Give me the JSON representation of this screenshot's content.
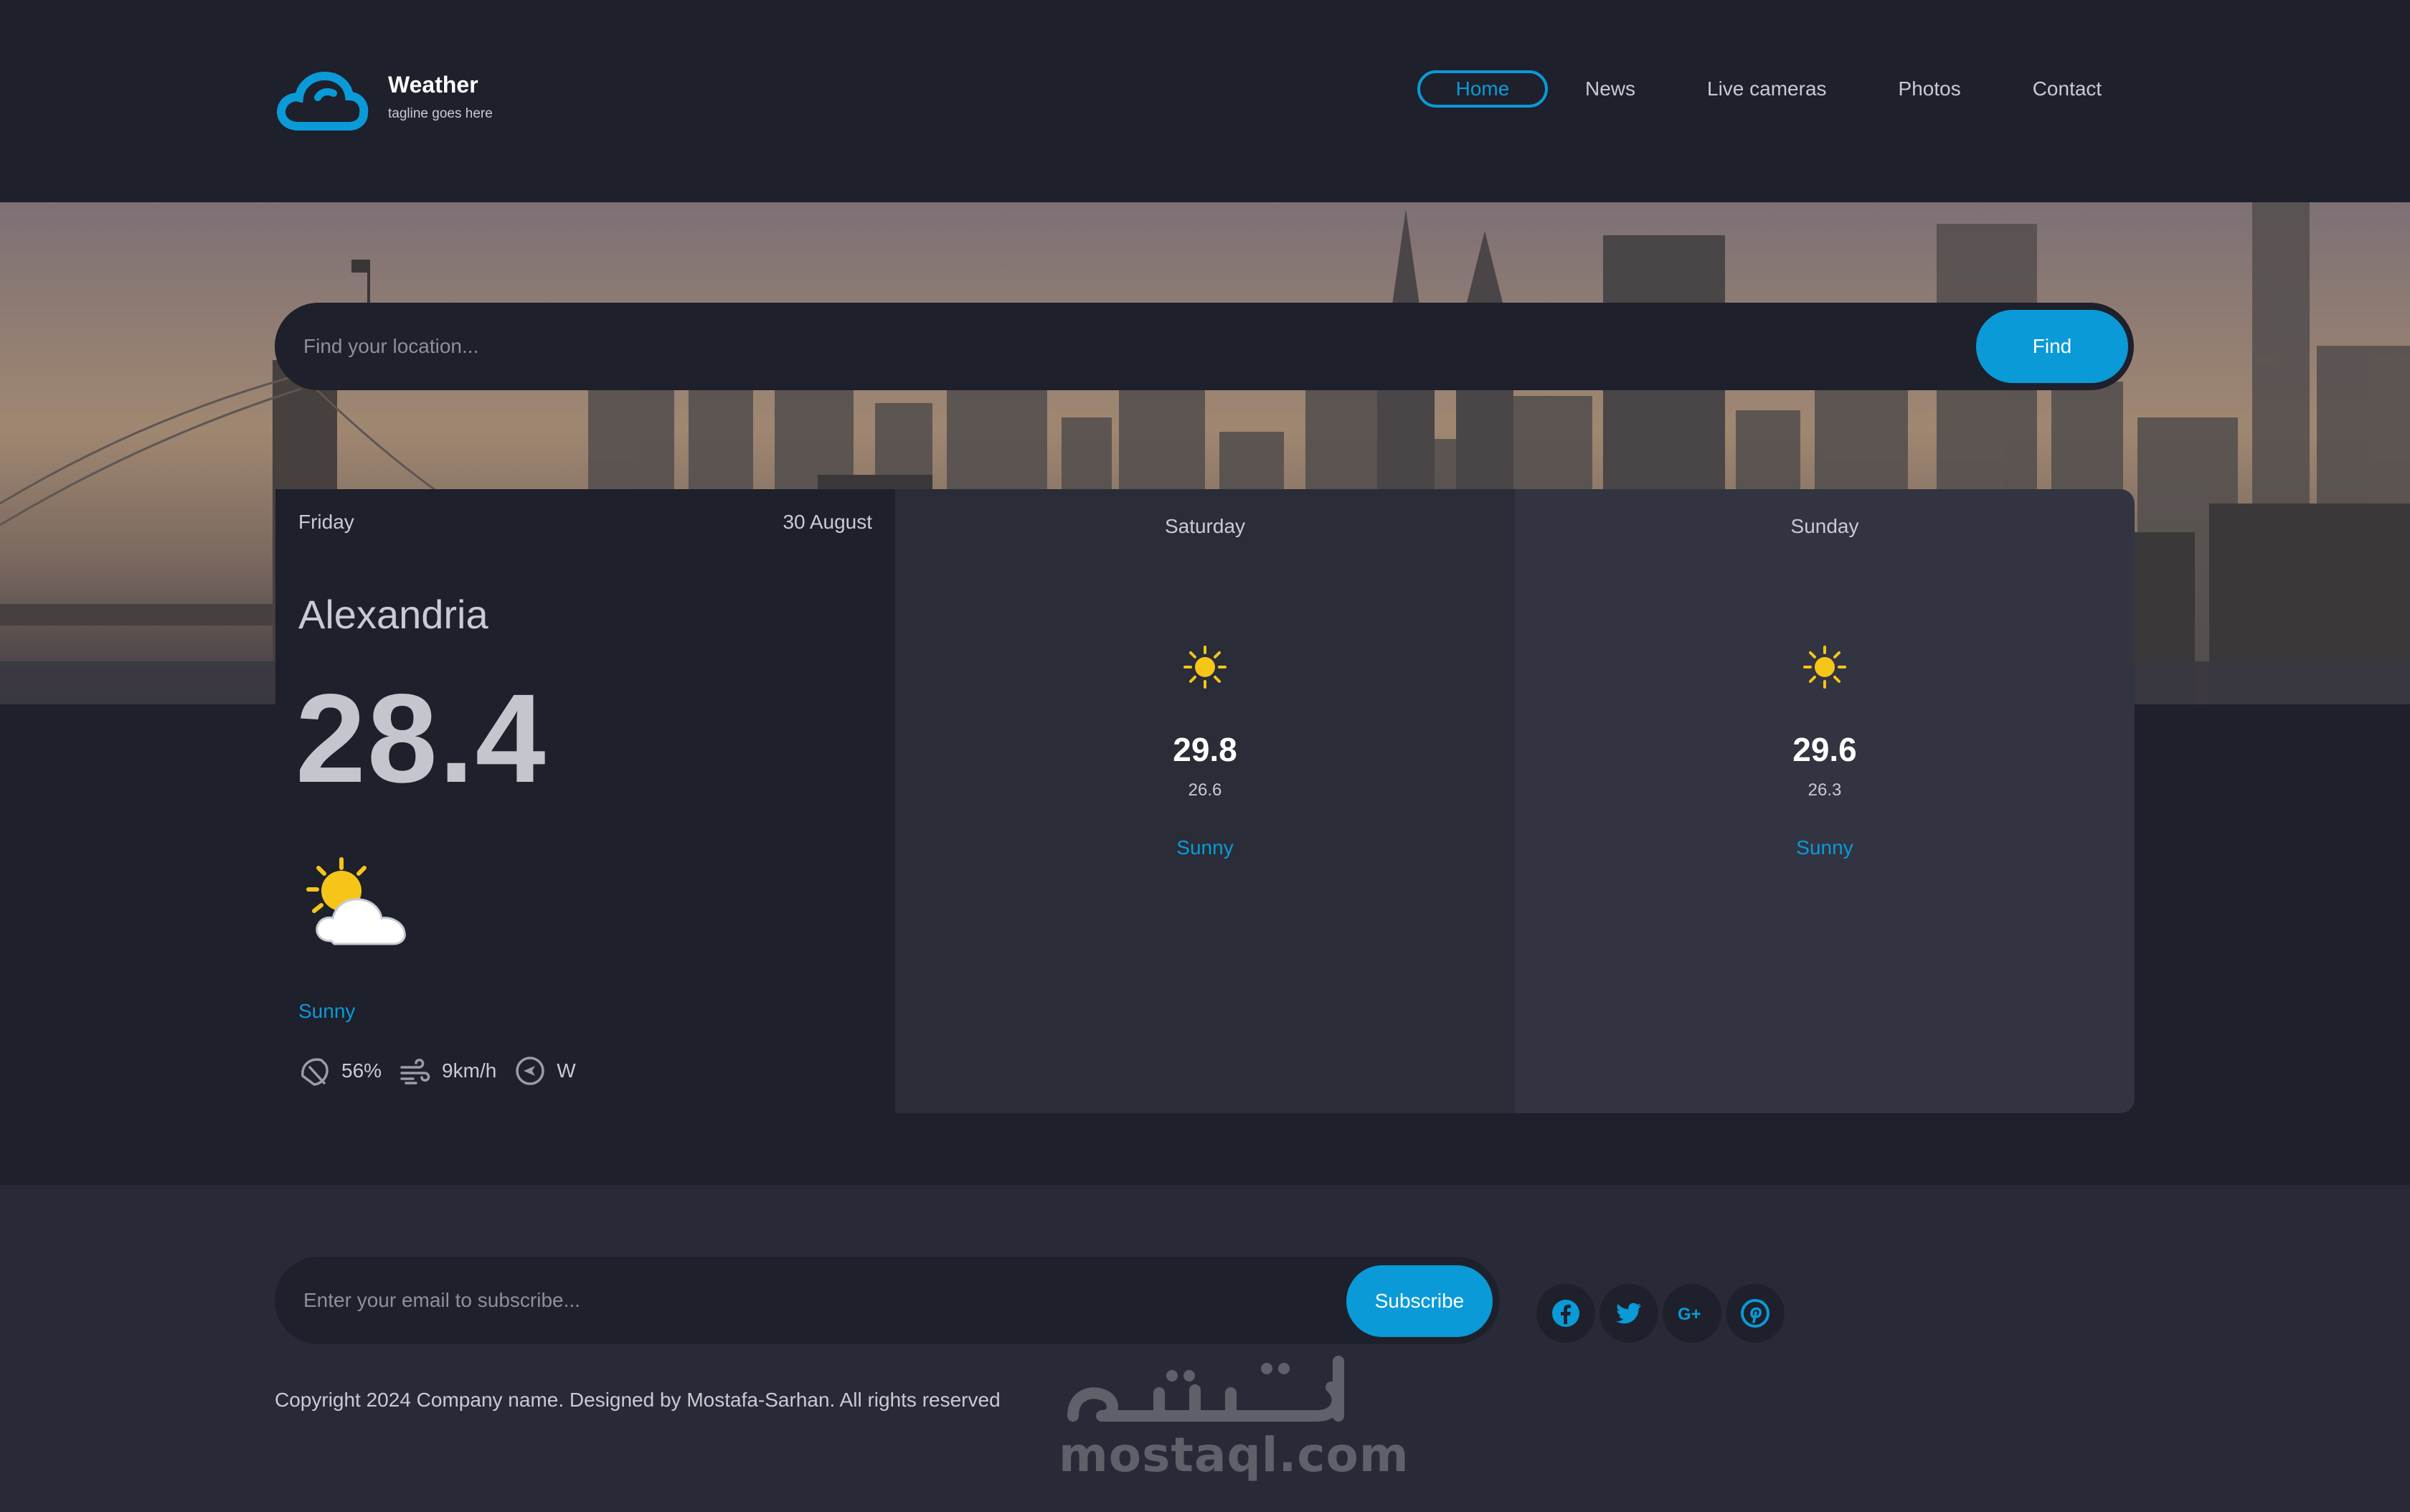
{
  "brand": {
    "title": "Weather",
    "tagline": "tagline goes here",
    "logo_icon": "cloud-icon"
  },
  "nav": {
    "items": [
      "Home",
      "News",
      "Live cameras",
      "Photos",
      "Contact"
    ],
    "active": "Home"
  },
  "search": {
    "placeholder": "Find your location...",
    "button": "Find"
  },
  "today": {
    "day": "Friday",
    "date": "30 August",
    "city": "Alexandria",
    "temp": "28.4",
    "icon": "partly-cloudy-icon",
    "condition": "Sunny",
    "stats": {
      "humidity": "56%",
      "wind": "9km/h",
      "direction": "W"
    }
  },
  "forecast": [
    {
      "day": "Saturday",
      "icon": "sun-icon",
      "max": "29.8",
      "min": "26.6",
      "condition": "Sunny"
    },
    {
      "day": "Sunday",
      "icon": "sun-icon",
      "max": "29.6",
      "min": "26.3",
      "condition": "Sunny"
    }
  ],
  "footer": {
    "email_placeholder": "Enter your email to subscribe...",
    "subscribe": "Subscribe",
    "socials": [
      "facebook-icon",
      "twitter-icon",
      "google-plus-icon",
      "pinterest-icon"
    ],
    "copyright": "Copyright 2024 Company name. Designed by Mostafa-Sarhan. All rights reserved"
  },
  "watermark": {
    "arabic": "مستقل",
    "latin": "mostaql.com"
  },
  "colors": {
    "accent": "#0a9ad8",
    "background": "#1e202b",
    "footer": "#282a38",
    "sun": "#f5c518"
  }
}
